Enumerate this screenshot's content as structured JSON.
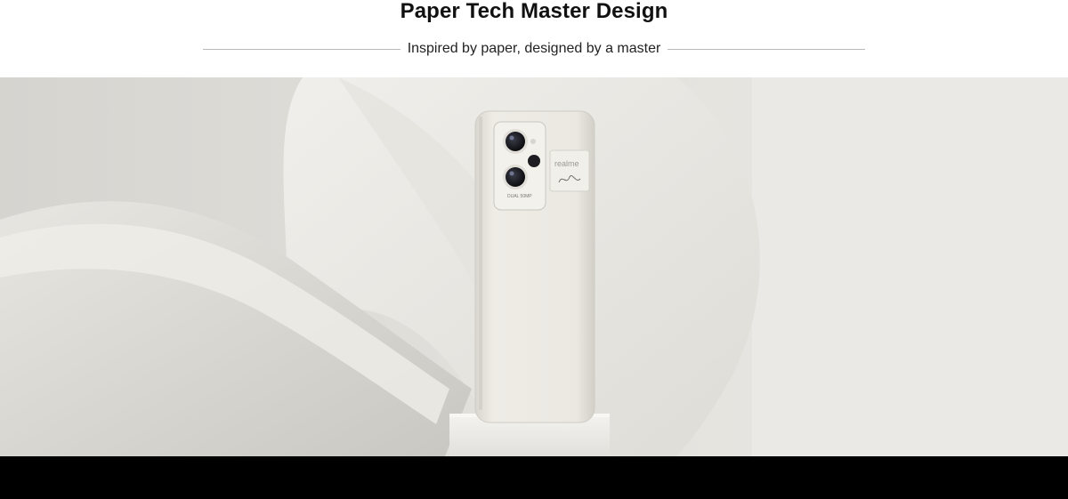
{
  "header": {
    "title": "Paper Tech Master Design",
    "subtitle": "Inspired by paper, designed by a master"
  },
  "hero": {
    "image_description": "White phone with paper-textured back standing on a white pedestal among curved paper sheets",
    "phone": {
      "camera_label": "DUAL 50MP",
      "badge_brand": "realme",
      "colors": {
        "body": "#ece9e2",
        "camera_plate": "#f3f1ec",
        "lens": "#1c1c1e"
      }
    }
  },
  "colors": {
    "background": "#ffffff",
    "hero_bg": "#dcdad5",
    "bottom_bar": "#000000",
    "title_text": "#111111",
    "rule": "#b9b9b9"
  }
}
